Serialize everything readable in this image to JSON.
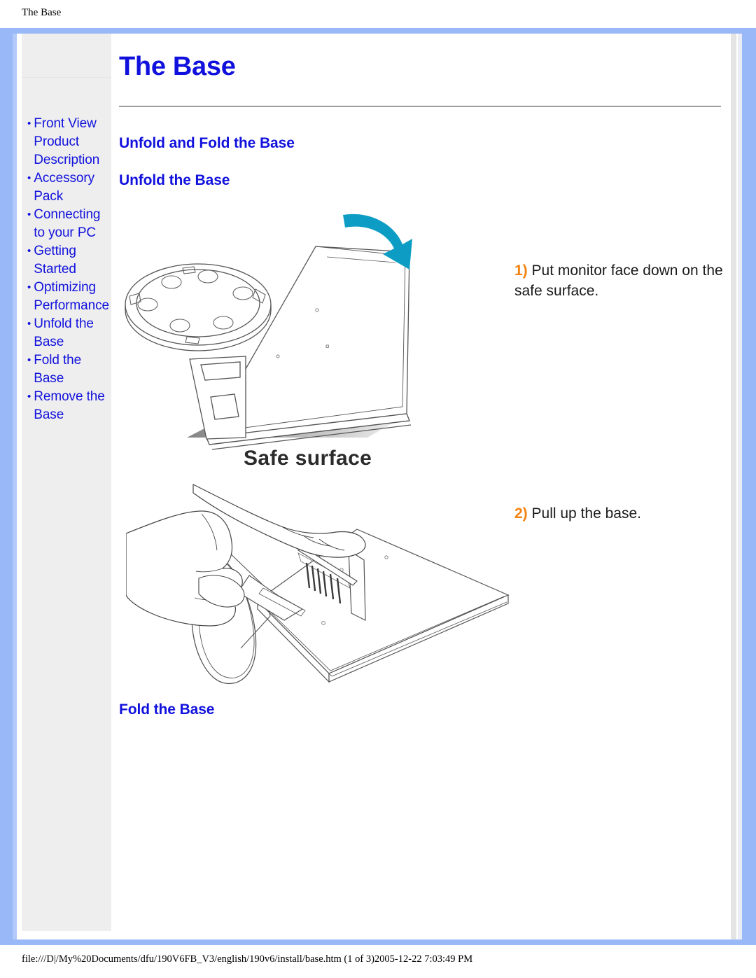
{
  "browser": {
    "header_title": "The Base",
    "footer_path": "file:///D|/My%20Documents/dfu/190V6FB_V3/english/190v6/install/base.htm (1 of 3)2005-12-22 7:03:49 PM"
  },
  "sidebar": {
    "items": [
      {
        "label": "Front View Product Description"
      },
      {
        "label": "Accessory Pack"
      },
      {
        "label": "Connecting to your PC"
      },
      {
        "label": "Getting Started"
      },
      {
        "label": "Optimizing Performance"
      },
      {
        "label": "Unfold the Base"
      },
      {
        "label": "Fold the Base"
      },
      {
        "label": "Remove the Base"
      }
    ]
  },
  "main": {
    "title": "The Base",
    "headings": {
      "unfold_and_fold": "Unfold and Fold the Base",
      "unfold": "Unfold the Base",
      "fold": "Fold the Base"
    },
    "steps": [
      {
        "number": "1)",
        "text": " Put monitor face down on the safe surface."
      },
      {
        "number": "2)",
        "text": " Pull up the base."
      }
    ],
    "figure_caption": "Safe surface"
  },
  "colors": {
    "frame_blue": "#99b8f7",
    "link_blue": "#1111dd",
    "step_orange": "#f4820f",
    "arrow_cyan": "#0d9dc4",
    "sidebar_gray": "#eeeeee"
  }
}
